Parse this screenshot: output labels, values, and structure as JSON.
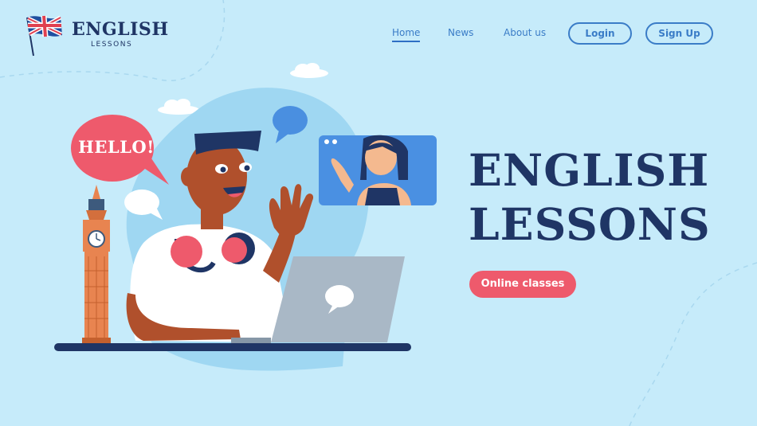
{
  "logo": {
    "title": "ENGLISH",
    "subtitle": "LESSONS",
    "icon": "uk-flag-icon"
  },
  "nav": {
    "home": "Home",
    "news": "News",
    "about": "About us",
    "login": "Login",
    "signup": "Sign Up"
  },
  "hero": {
    "title_line1": "ENGLISH",
    "title_line2": "LESSONS",
    "cta": "Online classes"
  },
  "illustration": {
    "speech_bubble": "HELLO!"
  },
  "colors": {
    "background": "#c6ebfa",
    "navy": "#1f3565",
    "accent_blue": "#3a7cc7",
    "cta_red": "#ee5a6c"
  }
}
